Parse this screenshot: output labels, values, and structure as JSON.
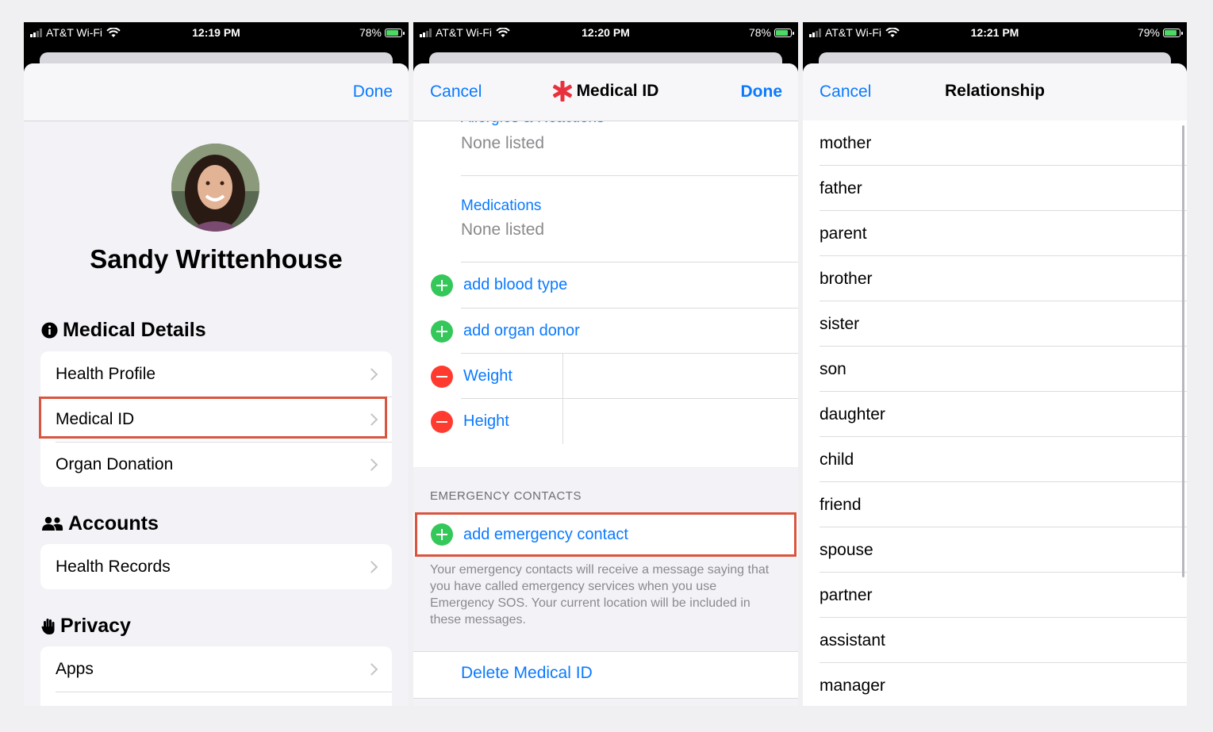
{
  "colors": {
    "accent": "#0a7aff",
    "highlight": "#d9553f",
    "add_green": "#34c759",
    "remove_red": "#ff3b30",
    "asterisk": "#e8313c"
  },
  "panels": [
    {
      "status": {
        "carrier": "AT&T Wi-Fi",
        "time": "12:19 PM",
        "battery": "78%"
      },
      "nav": {
        "done": "Done"
      },
      "profile": {
        "name": "Sandy Writtenhouse"
      },
      "sections": {
        "medical": {
          "title": "Medical Details",
          "icon": "info-circle-icon",
          "items": [
            {
              "label": "Health Profile"
            },
            {
              "label": "Medical ID"
            },
            {
              "label": "Organ Donation"
            }
          ]
        },
        "accounts": {
          "title": "Accounts",
          "icon": "people-icon",
          "items": [
            {
              "label": "Health Records"
            }
          ]
        },
        "privacy": {
          "title": "Privacy",
          "icon": "hand-icon",
          "items": [
            {
              "label": "Apps"
            }
          ]
        }
      }
    },
    {
      "status": {
        "carrier": "AT&T Wi-Fi",
        "time": "12:20 PM",
        "battery": "78%"
      },
      "nav": {
        "cancel": "Cancel",
        "title": "Medical ID",
        "done": "Done"
      },
      "fields": {
        "allergies": {
          "label": "Allergies & Reactions",
          "value": "None listed"
        },
        "medications": {
          "label": "Medications",
          "value": "None listed"
        }
      },
      "add_rows": [
        {
          "label": "add blood type"
        },
        {
          "label": "add organ donor"
        }
      ],
      "remove_rows": [
        {
          "label": "Weight"
        },
        {
          "label": "Height"
        }
      ],
      "emergency": {
        "caption": "EMERGENCY CONTACTS",
        "add_label": "add emergency contact",
        "footnote": "Your emergency contacts will receive a message saying that you have called emergency services when you use Emergency SOS. Your current location will be included in these messages."
      },
      "delete_label": "Delete Medical ID"
    },
    {
      "status": {
        "carrier": "AT&T Wi-Fi",
        "time": "12:21 PM",
        "battery": "79%"
      },
      "nav": {
        "cancel": "Cancel",
        "title": "Relationship"
      },
      "relationships": [
        "mother",
        "father",
        "parent",
        "brother",
        "sister",
        "son",
        "daughter",
        "child",
        "friend",
        "spouse",
        "partner",
        "assistant",
        "manager"
      ]
    }
  ]
}
